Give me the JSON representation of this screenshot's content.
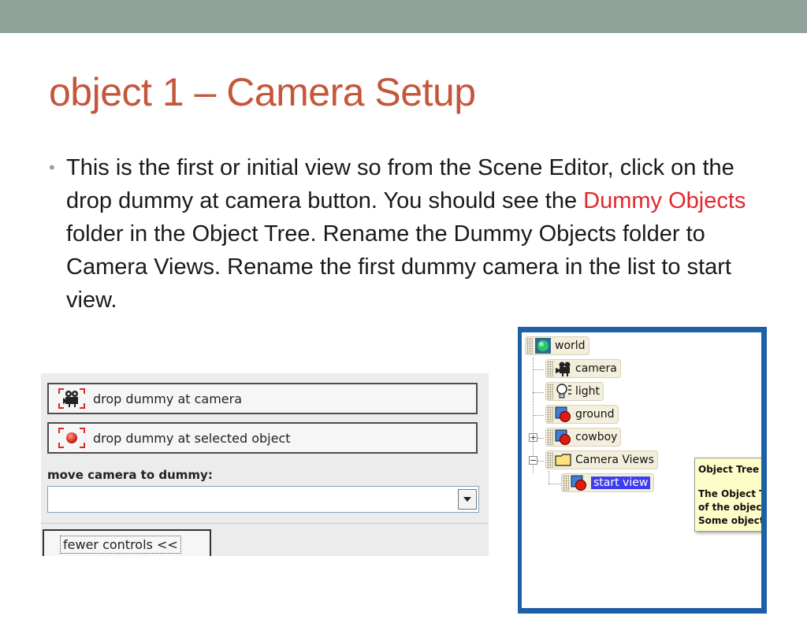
{
  "slide": {
    "title": "object 1 – Camera Setup",
    "bullet": {
      "part1": "This is the first or initial view so from the Scene Editor, click on the drop dummy at camera button. You should see the ",
      "highlight": "Dummy Objects",
      "part2": " folder in the Object Tree. Rename the Dummy Objects folder to Camera Views. Rename the first dummy camera in the list to start view."
    },
    "colors": {
      "title": "#c4573b",
      "highlight": "#e3262b",
      "topbar": "#8fa39a",
      "tree_frame": "#1d60a6",
      "selection": "#3d3df0"
    }
  },
  "scene_editor": {
    "drop_camera_label": "drop dummy at camera",
    "drop_camera_icon": "camera-icon",
    "drop_selected_label": "drop dummy at selected object",
    "drop_selected_icon": "red-ball-icon",
    "move_label": "move camera to dummy:",
    "move_value": "",
    "fewer_label": "fewer controls  <<"
  },
  "object_tree": {
    "nodes": {
      "world": "world",
      "camera": "camera",
      "light": "light",
      "ground": "ground",
      "cowboy": "cowboy",
      "camera_views": "Camera Views",
      "start_view": "start view"
    },
    "tooltip": {
      "title": "Object Tree",
      "line1": "The Object Tr",
      "line2": "of the objects",
      "line3": "Some objects"
    }
  }
}
